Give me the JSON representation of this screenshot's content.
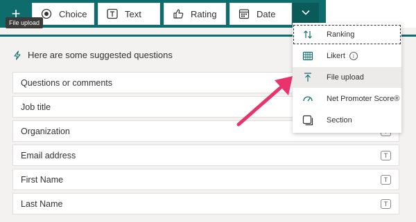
{
  "toolbar": {
    "add_symbol": "+",
    "tooltip": "File upload",
    "buttons": [
      {
        "label": "Choice",
        "icon": "radio-icon"
      },
      {
        "label": "Text",
        "icon": "text-box-icon"
      },
      {
        "label": "Rating",
        "icon": "thumbs-up-icon"
      },
      {
        "label": "Date",
        "icon": "calendar-icon"
      }
    ],
    "more_icon": "chevron-down-icon"
  },
  "colors": {
    "teal": "#0f6c6c",
    "arrow": "#e8336d"
  },
  "suggestions": {
    "header": "Here are some suggested questions",
    "items": [
      "Questions or comments",
      "Job title",
      "Organization",
      "Email address",
      "First Name",
      "Last Name"
    ],
    "row_icon_text": "T"
  },
  "menu": {
    "items": [
      {
        "label": "Ranking",
        "icon": "ranking-arrows-icon"
      },
      {
        "label": "Likert",
        "icon": "likert-grid-icon",
        "info": "i"
      },
      {
        "label": "File upload",
        "icon": "upload-icon"
      },
      {
        "label": "Net Promoter Score®",
        "icon": "gauge-icon"
      },
      {
        "label": "Section",
        "icon": "section-icon"
      }
    ]
  }
}
